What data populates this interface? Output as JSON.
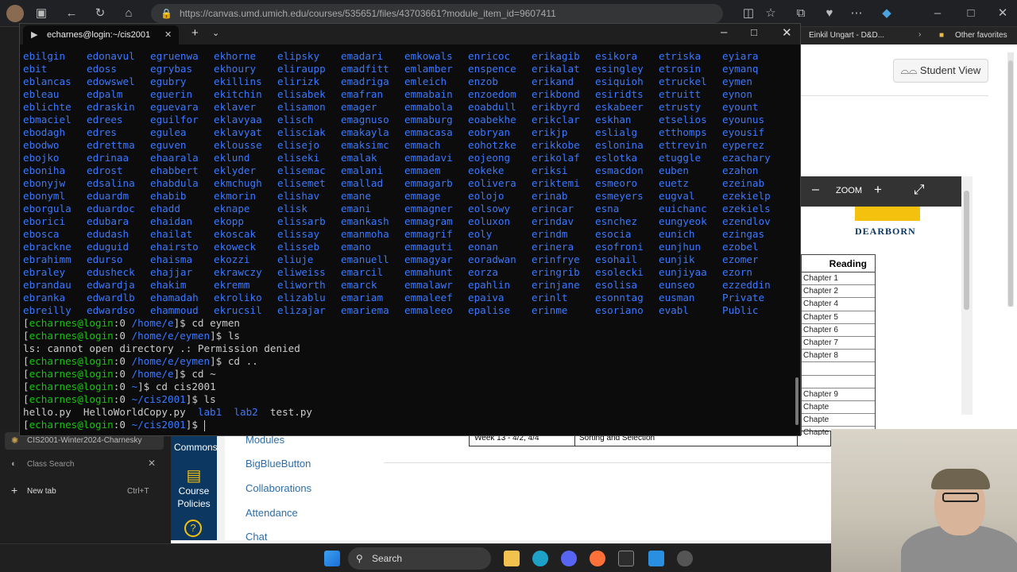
{
  "browser": {
    "url": "https://canvas.umd.umich.edu/courses/535651/files/43703661?module_item_id=9607411",
    "favorites": [
      {
        "label": "Einkil Ungart - D&D..."
      }
    ],
    "other_favorites": "Other favorites"
  },
  "terminal": {
    "tab_title": "echarnes@login:~/cis2001",
    "dir_rows": [
      [
        "ebilgin",
        "edonavul",
        "egruenwa",
        "ekhorne",
        "elipsky",
        "emadari",
        "emkowals",
        "enricoc",
        "erikagib",
        "esikora",
        "etriska",
        "eyiara"
      ],
      [
        "ebit",
        "edoss",
        "egrybas",
        "ekhoury",
        "eliraupp",
        "emadfitt",
        "emlamber",
        "enspence",
        "erikalat",
        "esingley",
        "etrosin",
        "eymanq"
      ],
      [
        "eblancas",
        "edowswel",
        "egubry",
        "ekillins",
        "elirizk",
        "emadriga",
        "emleich",
        "enzob",
        "erikand",
        "esiquioh",
        "etruckel",
        "eymen"
      ],
      [
        "ebleau",
        "edpalm",
        "eguerin",
        "ekitchin",
        "elisabek",
        "emafran",
        "emmabain",
        "enzoedom",
        "erikbond",
        "esiridts",
        "etruitt",
        "eynon"
      ],
      [
        "eblichte",
        "edraskin",
        "eguevara",
        "eklaver",
        "elisamon",
        "emager",
        "emmabola",
        "eoabdull",
        "erikbyrd",
        "eskabeer",
        "etrusty",
        "eyount"
      ],
      [
        "ebmaciel",
        "edrees",
        "eguilfor",
        "eklavyaa",
        "elisch",
        "emagnuso",
        "emmaburg",
        "eoabekhe",
        "erikclar",
        "eskhan",
        "etselios",
        "eyounus"
      ],
      [
        "ebodagh",
        "edres",
        "egulea",
        "eklavyat",
        "elisciak",
        "emakayla",
        "emmacasa",
        "eobryan",
        "erikjp",
        "eslialg",
        "etthomps",
        "eyousif"
      ],
      [
        "ebodwo",
        "edrettma",
        "eguven",
        "eklousse",
        "elisejo",
        "emaksimc",
        "emmach",
        "eohotzke",
        "erikkobe",
        "eslonina",
        "ettrevin",
        "eyperez"
      ],
      [
        "ebojko",
        "edrinaa",
        "ehaarala",
        "eklund",
        "eliseki",
        "emalak",
        "emmadavi",
        "eojeong",
        "erikolaf",
        "eslotka",
        "etuggle",
        "ezachary"
      ],
      [
        "eboniha",
        "edrost",
        "ehabbert",
        "eklyder",
        "elisemac",
        "emalani",
        "emmaem",
        "eokeke",
        "eriksi",
        "esmacdon",
        "euben",
        "ezahon"
      ],
      [
        "ebonyjw",
        "edsalina",
        "ehabdula",
        "ekmchugh",
        "elisemet",
        "emallad",
        "emmagarb",
        "eolivera",
        "eriktemi",
        "esmeoro",
        "euetz",
        "ezeinab"
      ],
      [
        "ebonyml",
        "eduardm",
        "ehabib",
        "ekmorin",
        "elishav",
        "emane",
        "emmage",
        "eolojo",
        "erinab",
        "esmeyers",
        "eugval",
        "ezekielp"
      ],
      [
        "eborgula",
        "eduardoc",
        "ehadd",
        "eknape",
        "elisk",
        "emani",
        "emmagner",
        "eolsowy",
        "erincar",
        "esna",
        "euichanc",
        "ezekiels"
      ],
      [
        "eborici",
        "edubara",
        "ehaidan",
        "ekopp",
        "elissarb",
        "emankash",
        "emmagram",
        "eoluxon",
        "erindav",
        "esnchez",
        "eungyeok",
        "ezendlov"
      ],
      [
        "ebosca",
        "edudash",
        "ehailat",
        "ekoscak",
        "elissay",
        "emanmoha",
        "emmagrif",
        "eoly",
        "erindm",
        "esocia",
        "eunich",
        "ezingas"
      ],
      [
        "ebrackne",
        "eduguid",
        "ehairsto",
        "ekoweck",
        "elisseb",
        "emano",
        "emmaguti",
        "eonan",
        "erinera",
        "esofroni",
        "eunjhun",
        "ezobel"
      ],
      [
        "ebrahimm",
        "edurso",
        "ehaisma",
        "ekozzi",
        "eliuje",
        "emanuell",
        "emmagyar",
        "eoradwan",
        "erinfrye",
        "esohail",
        "eunjik",
        "ezomer"
      ],
      [
        "ebraley",
        "edusheck",
        "ehajjar",
        "ekrawczy",
        "eliweiss",
        "emarcil",
        "emmahunt",
        "eorza",
        "eringrib",
        "esolecki",
        "eunjiyaa",
        "ezorn"
      ],
      [
        "ebrandau",
        "edwardja",
        "ehakim",
        "ekremm",
        "eliworth",
        "emarck",
        "emmalawr",
        "epahlin",
        "erinjane",
        "esolisa",
        "eunseo",
        "ezzeddin"
      ],
      [
        "ebranka",
        "edwardlb",
        "ehamadah",
        "ekroliko",
        "elizablu",
        "emariam",
        "emmaleef",
        "epaiva",
        "erinlt",
        "esonntag",
        "eusman",
        "Private"
      ],
      [
        "ebreilly",
        "edwardso",
        "ehammoud",
        "ekrucsil",
        "elizajar",
        "emariema",
        "emmaleeo",
        "epalise",
        "erinme",
        "esoriano",
        "evabl",
        "Public"
      ]
    ],
    "lines": [
      [
        {
          "t": "[",
          "c": "w"
        },
        {
          "t": "echarnes@login",
          "c": "g"
        },
        {
          "t": ":0 ",
          "c": "w"
        },
        {
          "t": "/home/e",
          "c": "b"
        },
        {
          "t": "]$ cd eymen",
          "c": "w"
        }
      ],
      [
        {
          "t": "[",
          "c": "w"
        },
        {
          "t": "echarnes@login",
          "c": "g"
        },
        {
          "t": ":0 ",
          "c": "w"
        },
        {
          "t": "/home/e/eymen",
          "c": "b"
        },
        {
          "t": "]$ ls",
          "c": "w"
        }
      ],
      [
        {
          "t": "ls: cannot open directory .: Permission denied",
          "c": "w"
        }
      ],
      [
        {
          "t": "[",
          "c": "w"
        },
        {
          "t": "echarnes@login",
          "c": "g"
        },
        {
          "t": ":0 ",
          "c": "w"
        },
        {
          "t": "/home/e/eymen",
          "c": "b"
        },
        {
          "t": "]$ cd ..",
          "c": "w"
        }
      ],
      [
        {
          "t": "[",
          "c": "w"
        },
        {
          "t": "echarnes@login",
          "c": "g"
        },
        {
          "t": ":0 ",
          "c": "w"
        },
        {
          "t": "/home/e",
          "c": "b"
        },
        {
          "t": "]$ cd ~",
          "c": "w"
        }
      ],
      [
        {
          "t": "[",
          "c": "w"
        },
        {
          "t": "echarnes@login",
          "c": "g"
        },
        {
          "t": ":0 ",
          "c": "w"
        },
        {
          "t": "~",
          "c": "b"
        },
        {
          "t": "]$ cd cis2001",
          "c": "w"
        }
      ],
      [
        {
          "t": "[",
          "c": "w"
        },
        {
          "t": "echarnes@login",
          "c": "g"
        },
        {
          "t": ":0 ",
          "c": "w"
        },
        {
          "t": "~/cis2001",
          "c": "b"
        },
        {
          "t": "]$ ls",
          "c": "w"
        }
      ],
      [
        {
          "t": "hello.py  HelloWorldCopy.py  ",
          "c": "w"
        },
        {
          "t": "lab1",
          "c": "b"
        },
        {
          "t": "  ",
          "c": "w"
        },
        {
          "t": "lab2",
          "c": "b"
        },
        {
          "t": "  test.py",
          "c": "w"
        }
      ],
      [
        {
          "t": "[",
          "c": "w"
        },
        {
          "t": "echarnes@login",
          "c": "g"
        },
        {
          "t": ":0 ",
          "c": "w"
        },
        {
          "t": "~/cis2001",
          "c": "b"
        },
        {
          "t": "]$ ",
          "c": "w"
        }
      ]
    ]
  },
  "tabs_sidebar": {
    "items": [
      {
        "label": "CIS2001-Winter2024-Charnesky"
      },
      {
        "label": "Class Search"
      }
    ],
    "new_tab": "New tab",
    "new_tab_shortcut": "Ctrl+T"
  },
  "canvas": {
    "student_view": "Student View",
    "zoom_label": "ZOOM",
    "dearborn": "DEARBORN",
    "reading_header": "Reading",
    "chapters": [
      "Chapter 1",
      "Chapter 2",
      "Chapter 4",
      "Chapter 5",
      "Chapter 6",
      "Chapter 7",
      "Chapter 8",
      "",
      "",
      "Chapter 9",
      "Chapte",
      "Chapte",
      "Chapte"
    ],
    "left_nav": [
      {
        "label": "Commons"
      },
      {
        "label": "Course Policies"
      }
    ],
    "course_nav": [
      "Modules",
      "BigBlueButton",
      "Collaborations",
      "Attendance",
      "Chat"
    ],
    "schedule_week": "Week 13 - 4/2, 4/4",
    "schedule_topic": "Sorting and Selection"
  },
  "taskbar": {
    "search_label": "Search"
  },
  "colors": {
    "prompt_user": "#16c60c",
    "path": "#3b78ff",
    "text": "#cccccc",
    "dir": "#3b78ff"
  }
}
